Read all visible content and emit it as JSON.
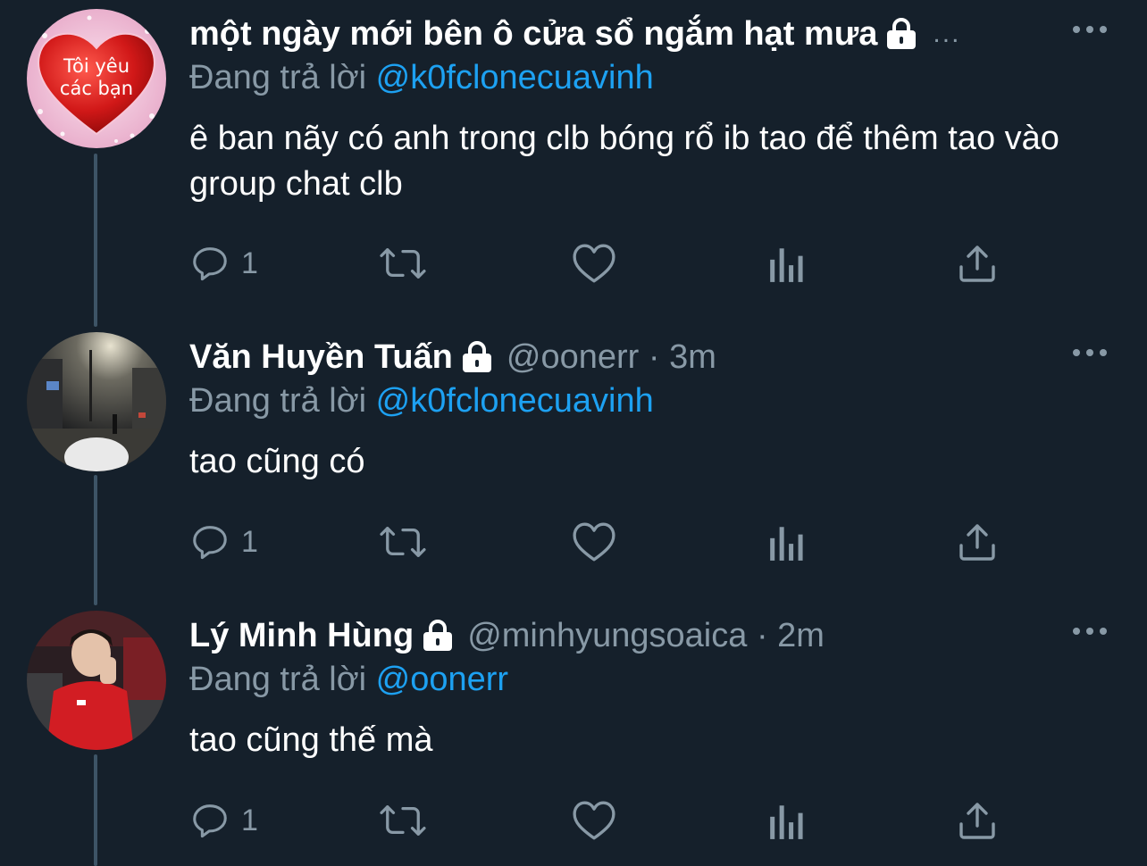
{
  "tweets": [
    {
      "display_name": "một ngày mới bên ô cửa sổ ngắm hạt mưa",
      "handle": "",
      "time": "",
      "truncation": "...",
      "locked": true,
      "reply_prefix": "Đang trả lời",
      "reply_to": "@k0fclonecuavinh",
      "text": "ê ban nãy có anh trong clb bóng rổ ib tao để thêm tao vào group chat clb",
      "avatar_caption": "Tôi yêu các bạn",
      "avatar_icon": "red-heart-avatar",
      "reply_count": "1"
    },
    {
      "display_name": "Văn Huyền Tuấn",
      "handle": "@oonerr",
      "time": "3m",
      "locked": true,
      "reply_prefix": "Đang trả lời",
      "reply_to": "@k0fclonecuavinh",
      "text": "tao cũng có",
      "avatar_icon": "night-street-photo-avatar",
      "reply_count": "1"
    },
    {
      "display_name": "Lý Minh Hùng",
      "handle": "@minhyungsoaica",
      "time": "2m",
      "locked": true,
      "reply_prefix": "Đang trả lời",
      "reply_to": "@oonerr",
      "text": "tao cũng thế mà",
      "avatar_icon": "person-red-jacket-avatar",
      "reply_count": "1"
    }
  ],
  "separator": "·",
  "colors": {
    "background": "#15202b",
    "text_primary": "#ffffff",
    "text_secondary": "#8899a6",
    "accent": "#1da1f2",
    "thread_line": "#3d5466"
  }
}
